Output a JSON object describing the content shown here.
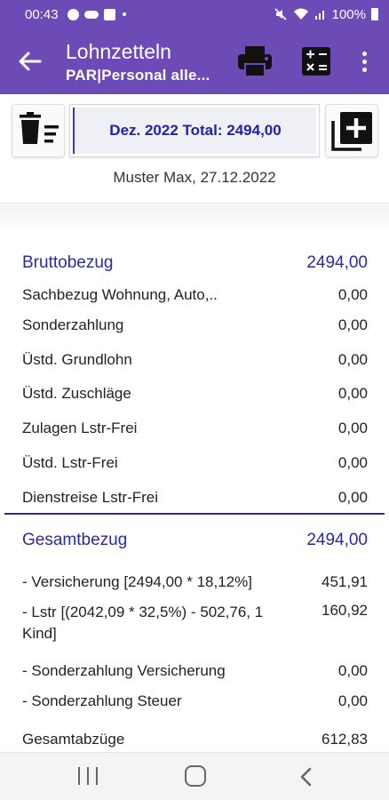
{
  "status_bar": {
    "time": "00:43",
    "battery": "100%",
    "icons": [
      "info-icon",
      "cloud-icon",
      "linkedin-icon",
      "dot-icon",
      "mute-icon",
      "wifi-icon",
      "signal-icon",
      "battery-icon"
    ]
  },
  "appbar": {
    "title": "Lohnzetteln",
    "subtitle": "PAR|Personal alle...",
    "icons": [
      "back-arrow-icon",
      "printer-icon",
      "calculator-icon",
      "more-vert-icon"
    ]
  },
  "toolbar": {
    "period_total": "Dez. 2022 Total: 2494,00",
    "icons": [
      "delete-list-icon",
      "add-item-icon"
    ]
  },
  "employee_line": "Muster Max, 27.12.2022",
  "brutto": {
    "header_label": "Bruttobezug",
    "header_value": "2494,00",
    "items": [
      {
        "label": "Sachbezug Wohnung, Auto,..",
        "value": "0,00"
      },
      {
        "label": "Sonderzahlung",
        "value": "0,00"
      },
      {
        "label": "Üstd. Grundlohn",
        "value": "0,00"
      },
      {
        "label": "Üstd. Zuschläge",
        "value": "0,00"
      },
      {
        "label": "Zulagen Lstr-Frei",
        "value": "0,00"
      },
      {
        "label": "Üstd. Lstr-Frei",
        "value": "0,00"
      },
      {
        "label": "Dienstreise Lstr-Frei",
        "value": "0,00"
      }
    ]
  },
  "gesamt": {
    "header_label": "Gesamtbezug",
    "header_value": "2494,00",
    "items": [
      {
        "label": "- Versicherung [2494,00 * 18,12%]",
        "value": "451,91"
      },
      {
        "label": "- Lstr [(2042,09 * 32,5%) - 502,76, 1 Kind]",
        "value": "160,92"
      },
      {
        "label": "- Sonderzahlung Versicherung",
        "value": "0,00"
      },
      {
        "label": "- Sonderzahlung Steuer",
        "value": "0,00"
      }
    ],
    "total_label": "Gesamtabzüge",
    "total_value": "612,83"
  },
  "colors": {
    "primary": "#6c4bb6",
    "accent_text": "#2a2aa8"
  },
  "navbar": {
    "icons": [
      "recent-apps-icon",
      "home-icon",
      "back-icon"
    ]
  }
}
